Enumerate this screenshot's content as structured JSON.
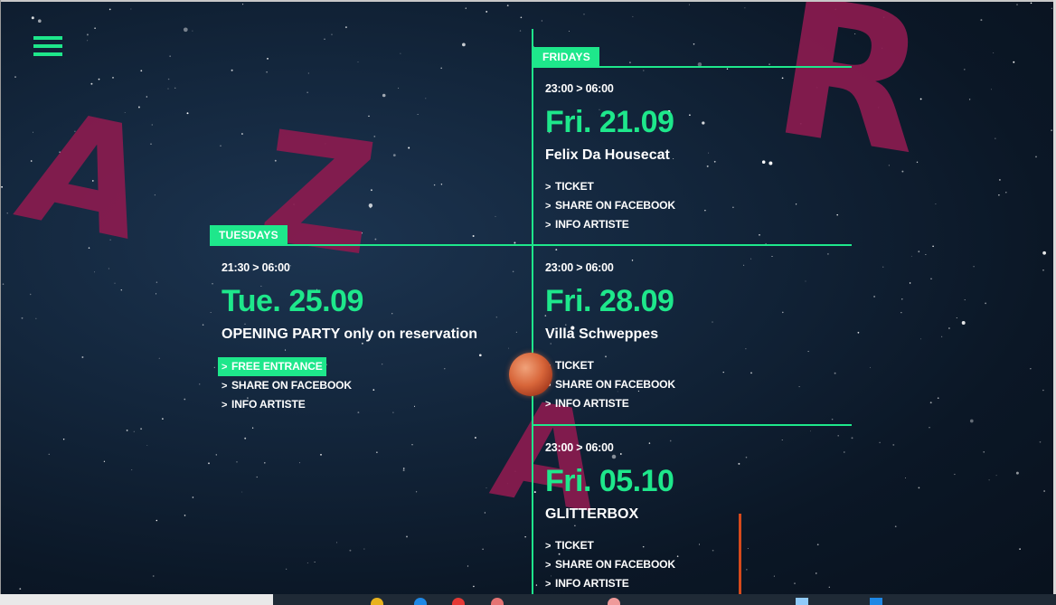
{
  "menu": {
    "icon": "hamburger-menu-icon"
  },
  "background_letters": [
    "A",
    "Z",
    "R",
    "A"
  ],
  "colors": {
    "accent": "#1ee78b",
    "letters": "#8a1b4f",
    "background": "#0d1b2c",
    "orange": "#d64a1c"
  },
  "sections": {
    "fridays": {
      "label": "FRIDAYS"
    },
    "tuesdays": {
      "label": "TUESDAYS"
    }
  },
  "events": {
    "fri1": {
      "time": "23:00 > 06:00",
      "date": "Fri. 21.09",
      "name": "Felix Da Housecat",
      "links": [
        "TICKET",
        "SHARE ON FACEBOOK",
        "INFO ARTISTE"
      ]
    },
    "tue": {
      "time": "21:30 > 06:00",
      "date": "Tue. 25.09",
      "name": "OPENING PARTY only on reservation",
      "links": [
        "FREE ENTRANCE",
        "SHARE ON FACEBOOK",
        "INFO ARTISTE"
      ]
    },
    "fri2": {
      "time": "23:00 > 06:00",
      "date": "Fri. 28.09",
      "name": "Villa Schweppes",
      "links": [
        "TICKET",
        "SHARE ON FACEBOOK",
        "INFO ARTISTE"
      ]
    },
    "fri3": {
      "time": "23:00 > 06:00",
      "date": "Fri. 05.10",
      "name": "GLITTERBOX",
      "links": [
        "TICKET",
        "SHARE ON FACEBOOK",
        "INFO ARTISTE"
      ]
    }
  }
}
